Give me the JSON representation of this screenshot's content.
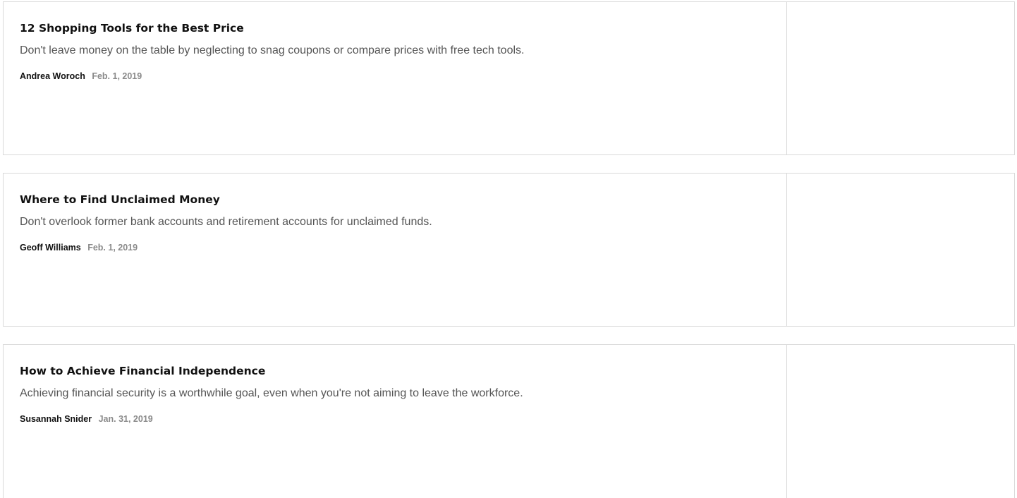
{
  "articles": [
    {
      "title": "12 Shopping Tools for the Best Price",
      "description": "Don't leave money on the table by neglecting to snag coupons or compare prices with free tech tools.",
      "author": "Andrea Woroch",
      "date": "Feb. 1, 2019"
    },
    {
      "title": "Where to Find Unclaimed Money",
      "description": "Don't overlook former bank accounts and retirement accounts for unclaimed funds.",
      "author": "Geoff Williams",
      "date": "Feb. 1, 2019"
    },
    {
      "title": "How to Achieve Financial Independence",
      "description": "Achieving financial security is a worthwhile goal, even when you're not aiming to leave the workforce.",
      "author": "Susannah Snider",
      "date": "Jan. 31, 2019"
    }
  ]
}
